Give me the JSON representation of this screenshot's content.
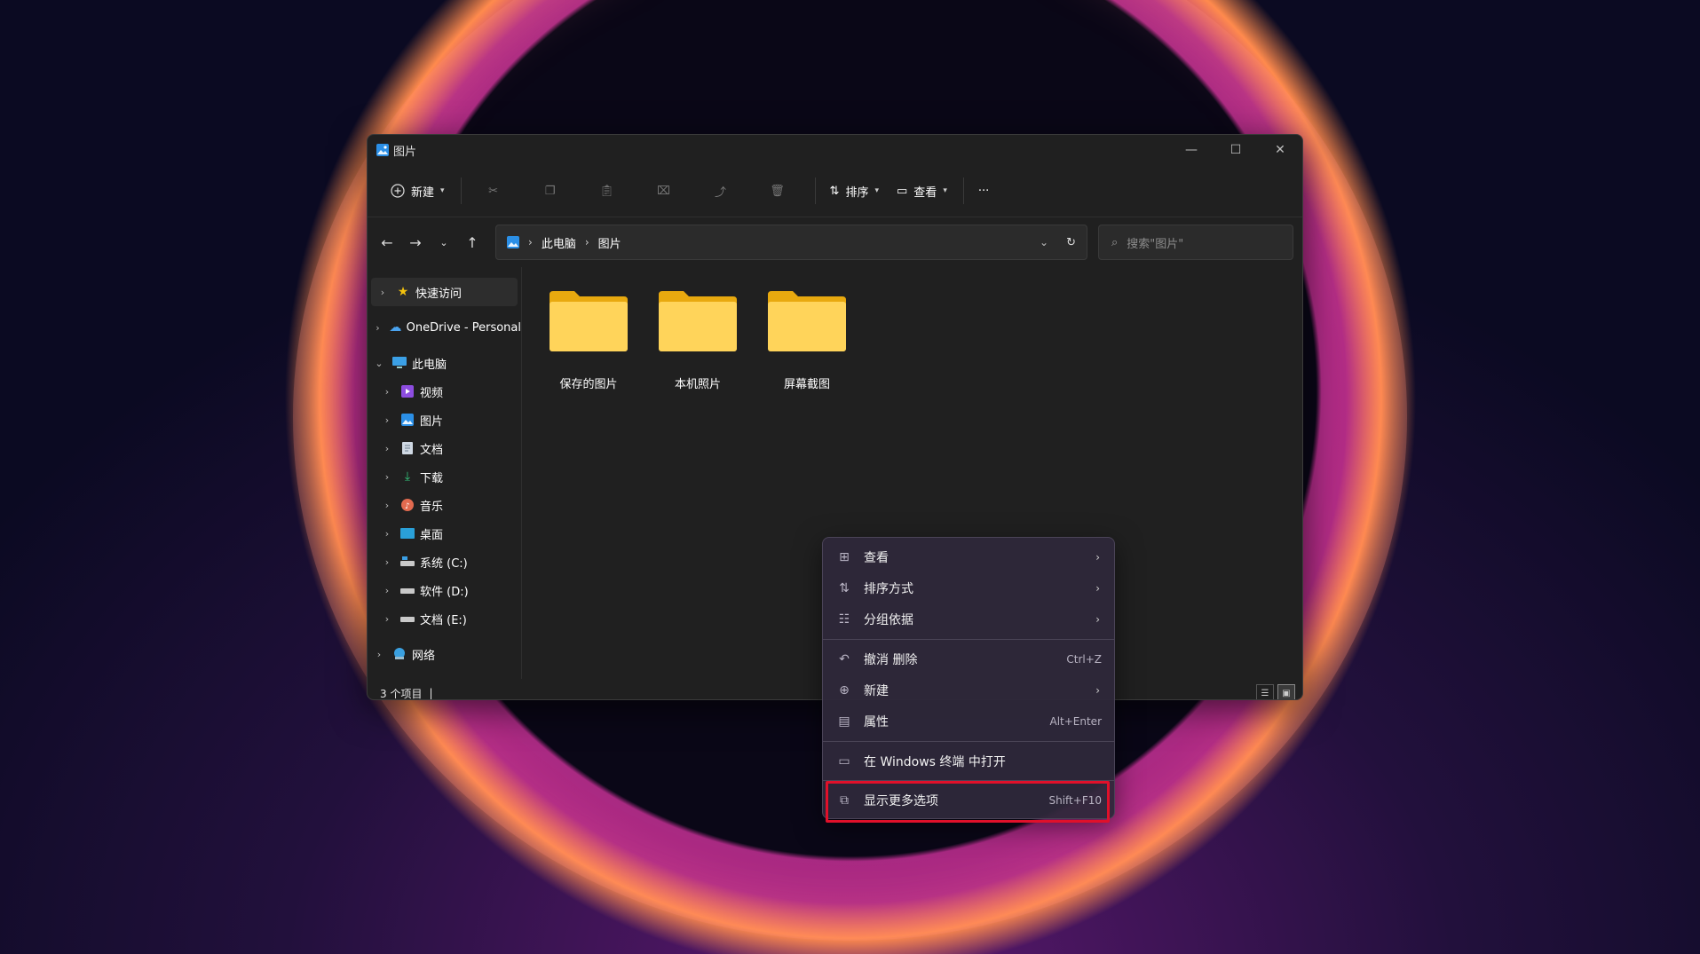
{
  "window": {
    "title": "图片",
    "caption": {
      "minimize": "—",
      "maximize": "☐",
      "close": "✕"
    }
  },
  "toolbar": {
    "new_label": "新建",
    "sort_label": "排序",
    "view_label": "查看",
    "more": "···",
    "icons": [
      "cut-icon",
      "copy-icon",
      "paste-icon",
      "rename-icon",
      "share-icon",
      "delete-icon"
    ]
  },
  "address": {
    "crumbs": [
      "此电脑",
      "图片"
    ],
    "search_placeholder": "搜索\"图片\""
  },
  "sidebar": {
    "items": [
      {
        "label": "快速访问",
        "icon": "star-icon"
      },
      {
        "label": "OneDrive - Personal",
        "icon": "cloud-icon"
      },
      {
        "label": "此电脑",
        "icon": "computer-icon"
      },
      {
        "label": "视频",
        "icon": "video-icon"
      },
      {
        "label": "图片",
        "icon": "pictures-icon"
      },
      {
        "label": "文档",
        "icon": "document-icon"
      },
      {
        "label": "下载",
        "icon": "download-icon"
      },
      {
        "label": "音乐",
        "icon": "music-icon"
      },
      {
        "label": "桌面",
        "icon": "desktop-icon"
      },
      {
        "label": "系统 (C:)",
        "icon": "drive-icon"
      },
      {
        "label": "软件 (D:)",
        "icon": "drive-icon"
      },
      {
        "label": "文档 (E:)",
        "icon": "drive-icon"
      },
      {
        "label": "网络",
        "icon": "network-icon"
      }
    ]
  },
  "folders": [
    {
      "label": "保存的图片"
    },
    {
      "label": "本机照片"
    },
    {
      "label": "屏幕截图"
    }
  ],
  "status": {
    "count": "3 个项目",
    "cursor": "|"
  },
  "context_menu": {
    "items": [
      {
        "label": "查看",
        "shortcut": ""
      },
      {
        "label": "排序方式",
        "shortcut": ""
      },
      {
        "label": "分组依据",
        "shortcut": ""
      },
      {
        "label": "撤消 删除",
        "shortcut": "Ctrl+Z"
      },
      {
        "label": "新建",
        "shortcut": ""
      },
      {
        "label": "属性",
        "shortcut": "Alt+Enter"
      },
      {
        "label": "在 Windows 终端 中打开",
        "shortcut": ""
      },
      {
        "label": "显示更多选项",
        "shortcut": "Shift+F10"
      }
    ]
  },
  "colors": {
    "highlight": "#e0102a",
    "folder": "#ffd45a",
    "accent": "#0078d4"
  }
}
